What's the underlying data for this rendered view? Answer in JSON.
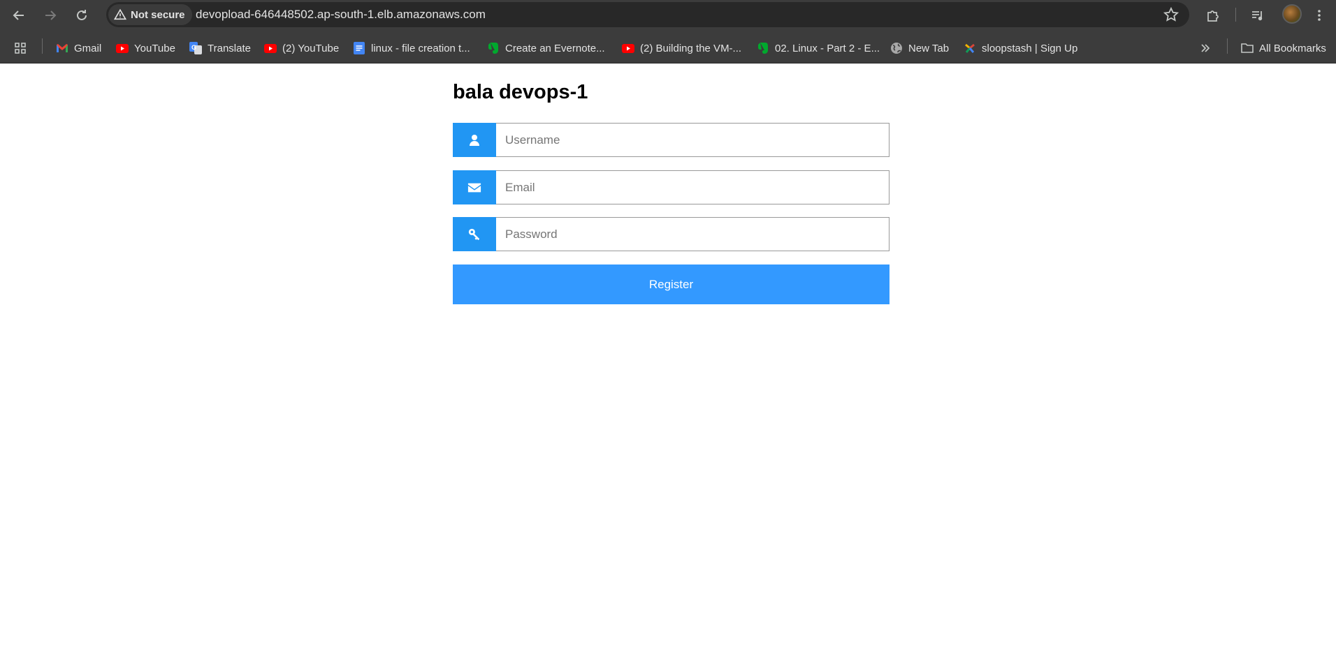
{
  "browser": {
    "security_label": "Not secure",
    "url": "devopload-646448502.ap-south-1.elb.amazonaws.com",
    "bookmarks": [
      {
        "label": "Gmail",
        "icon": "gmail-icon"
      },
      {
        "label": "YouTube",
        "icon": "youtube-icon"
      },
      {
        "label": "Translate",
        "icon": "translate-icon"
      },
      {
        "label": "(2) YouTube",
        "icon": "youtube-icon"
      },
      {
        "label": "linux - file creation t...",
        "icon": "docs-icon"
      },
      {
        "label": "Create an Evernote...",
        "icon": "evernote-icon"
      },
      {
        "label": "(2) Building the VM-...",
        "icon": "youtube-icon"
      },
      {
        "label": "02. Linux - Part 2 - E...",
        "icon": "evernote-icon"
      },
      {
        "label": "New Tab",
        "icon": "globe-icon"
      },
      {
        "label": "sloopstash | Sign Up",
        "icon": "sloopstash-icon"
      }
    ],
    "all_bookmarks_label": "All Bookmarks"
  },
  "form": {
    "title": "bala devops-1",
    "username_placeholder": "Username",
    "email_placeholder": "Email",
    "password_placeholder": "Password",
    "register_label": "Register"
  },
  "colors": {
    "addon_blue": "#2196f3",
    "button_blue": "#3399ff",
    "chrome_dark": "#3c3c3c"
  }
}
